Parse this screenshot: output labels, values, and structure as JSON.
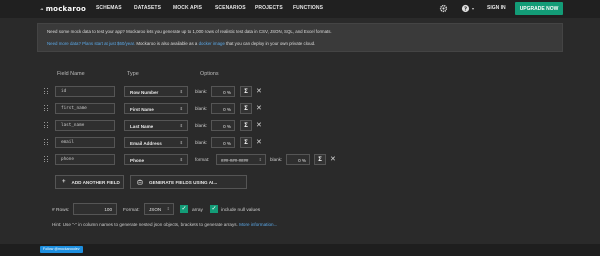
{
  "header": {
    "logo_text": "mockaroo",
    "nav": [
      "SCHEMAS",
      "DATASETS",
      "MOCK APIS",
      "SCENARIOS",
      "PROJECTS",
      "FUNCTIONS"
    ],
    "sign_in": "SIGN IN",
    "upgrade": "UPGRADE NOW"
  },
  "banner": {
    "line1": "Need some mock data to test your app? Mockaroo lets you generate up to 1,000 rows of realistic test data in CSV, JSON, SQL, and Excel formats.",
    "line2_link": "Need more data? Plans start at just $60/year.",
    "line2_mid": " Mockaroo is also available as a ",
    "line2_link2": "docker image",
    "line2_end": " that you can deploy in your own private cloud."
  },
  "columns": {
    "field_name": "Field Name",
    "type": "Type",
    "options": "Options"
  },
  "blank_label": "blank:",
  "format_label": "format:",
  "fields": [
    {
      "name": "id",
      "type": "Row Number",
      "blank": "0 %"
    },
    {
      "name": "first_name",
      "type": "First Name",
      "blank": "0 %"
    },
    {
      "name": "last_name",
      "type": "Last Name",
      "blank": "0 %"
    },
    {
      "name": "email",
      "type": "Email Address",
      "blank": "0 %"
    },
    {
      "name": "phone",
      "type": "Phone",
      "format": "###-###-####",
      "blank": "0 %"
    }
  ],
  "sigma": "Σ",
  "actions": {
    "add_field": "ADD ANOTHER FIELD",
    "generate": "GENERATE FIELDS USING AI..."
  },
  "options": {
    "rows_label": "# Rows:",
    "rows_value": "100",
    "format_label": "Format:",
    "format_value": "JSON",
    "array_label": "array",
    "null_label": "include null values"
  },
  "hint": {
    "text": "Hint: Use \"-\" in column names to generate nested json objects, brackets to generate arrays. ",
    "link": "More information..."
  },
  "footer": {
    "twitter": "Follow @mockaroodev"
  },
  "colors": {
    "accent": "#139c77",
    "link": "#5aa8e8",
    "background": "#2a2a2a"
  }
}
